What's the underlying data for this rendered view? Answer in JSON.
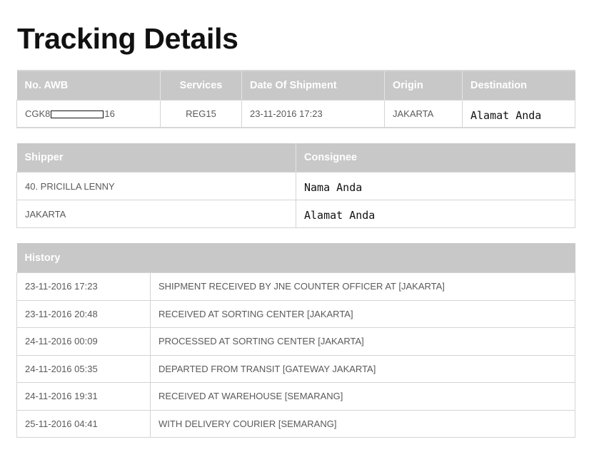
{
  "page": {
    "title": "Tracking Details"
  },
  "awb_table": {
    "headers": [
      "No. AWB",
      "Services",
      "Date Of Shipment",
      "Origin",
      "Destination"
    ],
    "row": {
      "awb_prefix": "CGK8",
      "awb_suffix": "16",
      "service": "REG15",
      "date": "23-11-2016 17:23",
      "origin": "JAKARTA",
      "destination": "Alamat Anda"
    }
  },
  "party_table": {
    "headers": [
      "Shipper",
      "Consignee"
    ],
    "rows": [
      [
        "40. PRICILLA LENNY",
        "Nama Anda"
      ],
      [
        "JAKARTA",
        "Alamat Anda"
      ]
    ]
  },
  "history_table": {
    "header": "History",
    "rows": [
      [
        "23-11-2016 17:23",
        "SHIPMENT RECEIVED BY JNE COUNTER OFFICER AT [JAKARTA]"
      ],
      [
        "23-11-2016 20:48",
        "RECEIVED AT SORTING CENTER [JAKARTA]"
      ],
      [
        "24-11-2016 00:09",
        "PROCESSED AT SORTING CENTER [JAKARTA]"
      ],
      [
        "24-11-2016 05:35",
        "DEPARTED FROM TRANSIT [GATEWAY JAKARTA]"
      ],
      [
        "24-11-2016 19:31",
        "RECEIVED AT WAREHOUSE [SEMARANG]"
      ],
      [
        "25-11-2016 04:41",
        "WITH DELIVERY COURIER [SEMARANG]"
      ]
    ]
  }
}
